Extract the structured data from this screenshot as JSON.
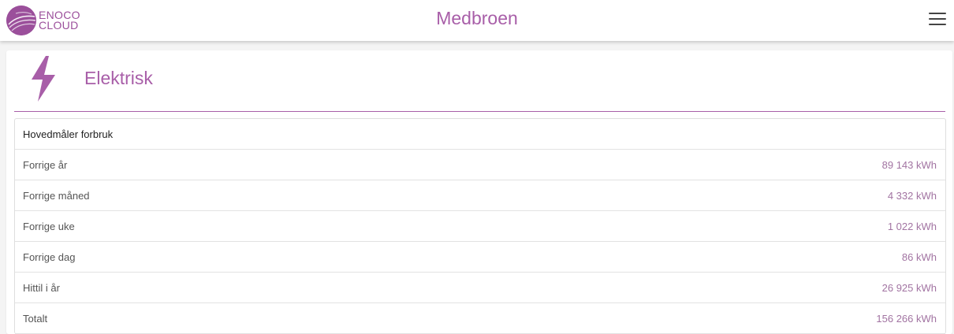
{
  "header": {
    "logo_line1": "ENOCO",
    "logo_line2": "CLOUD",
    "title": "Medbroen",
    "menu_icon": "hamburger-menu-icon"
  },
  "card": {
    "icon": "lightning-bolt-icon",
    "title": "Elektrisk"
  },
  "table": {
    "heading": "Hovedmåler forbruk",
    "rows": [
      {
        "label": "Forrige år",
        "value": "89 143 kWh"
      },
      {
        "label": "Forrige måned",
        "value": "4 332 kWh"
      },
      {
        "label": "Forrige uke",
        "value": "1 022 kWh"
      },
      {
        "label": "Forrige dag",
        "value": "86 kWh"
      },
      {
        "label": "Hittil i år",
        "value": "26 925 kWh"
      },
      {
        "label": "Totalt",
        "value": "156 266 kWh"
      }
    ]
  },
  "colors": {
    "brand": "#9b4f9b",
    "accent": "#a85ea8",
    "value_text": "#a274a2"
  }
}
